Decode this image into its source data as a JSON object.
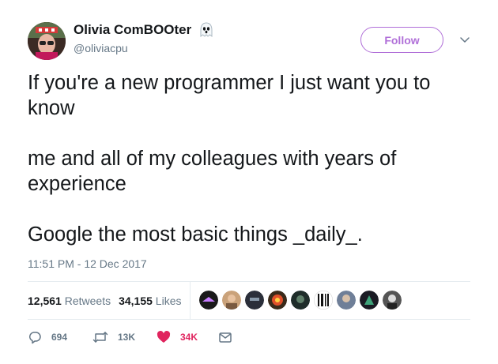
{
  "user": {
    "name": "Olivia ComBOOter",
    "handle": "@oliviacpu",
    "name_emoji_icon": "ghost-icon"
  },
  "follow_label": "Follow",
  "tweet": {
    "lines": [
      "If you're a new programmer I just want you to know",
      "me and all of my colleagues with years of experience",
      "Google the most basic things _daily_."
    ],
    "timestamp": "11:51 PM - 12 Dec 2017"
  },
  "stats": {
    "retweets_count": "12,561",
    "retweets_label": "Retweets",
    "likes_count": "34,155",
    "likes_label": "Likes"
  },
  "actions": {
    "reply_count": "694",
    "retweet_count": "13K",
    "like_count": "34K"
  },
  "colors": {
    "follow_accent": "#b06fd8",
    "like_red": "#e0245e",
    "meta_gray": "#657786"
  }
}
